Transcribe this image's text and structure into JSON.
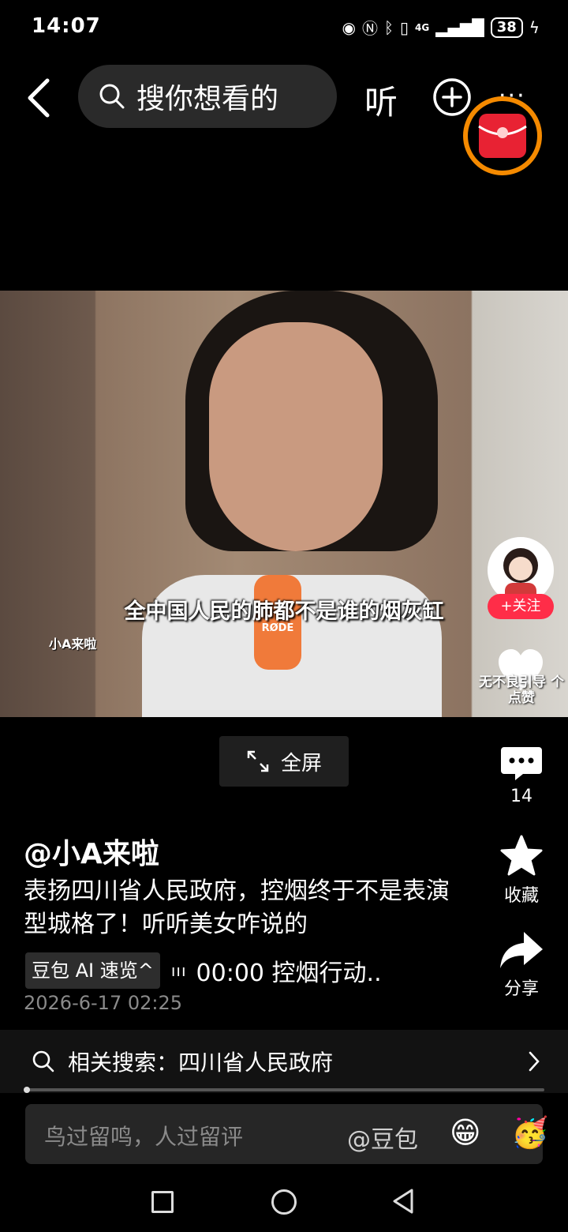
{
  "status_bar": {
    "time": "14:07",
    "network": "4G",
    "battery": "38"
  },
  "top_bar": {
    "search_placeholder": "搜你想看的",
    "listen_label": "听",
    "more_label": "···"
  },
  "video": {
    "subtitle": "全中国人民的肺都不是谁的烟灰缸",
    "watermark": "小A来啦",
    "mic_text": "RØDE"
  },
  "actions": {
    "follow_label": "+关注",
    "like_label": "无不良引导 个点赞",
    "comment_count": "14",
    "favorite_label": "收藏",
    "share_label": "分享"
  },
  "fullscreen_label": "全屏",
  "post": {
    "author": "@小A来啦",
    "description": "表扬四川省人民政府，控烟终于不是表演型城格了！听听美女咋说的",
    "ai_badge": "豆包 AI 速览^",
    "ai_bars": "ııı",
    "ai_summary": "00:00 控烟行动..",
    "date": "2026-6-17 02:25"
  },
  "related_search": {
    "label": "相关搜索：四川省人民政府"
  },
  "comment_bar": {
    "placeholder": "鸟过留鸣，人过留评",
    "mention": "@豆包",
    "emoji1": "😁",
    "emoji2": "🥳"
  },
  "colors": {
    "accent_red": "#ff2d48",
    "redpacket_ring": "#f58a00",
    "background": "#000000"
  }
}
